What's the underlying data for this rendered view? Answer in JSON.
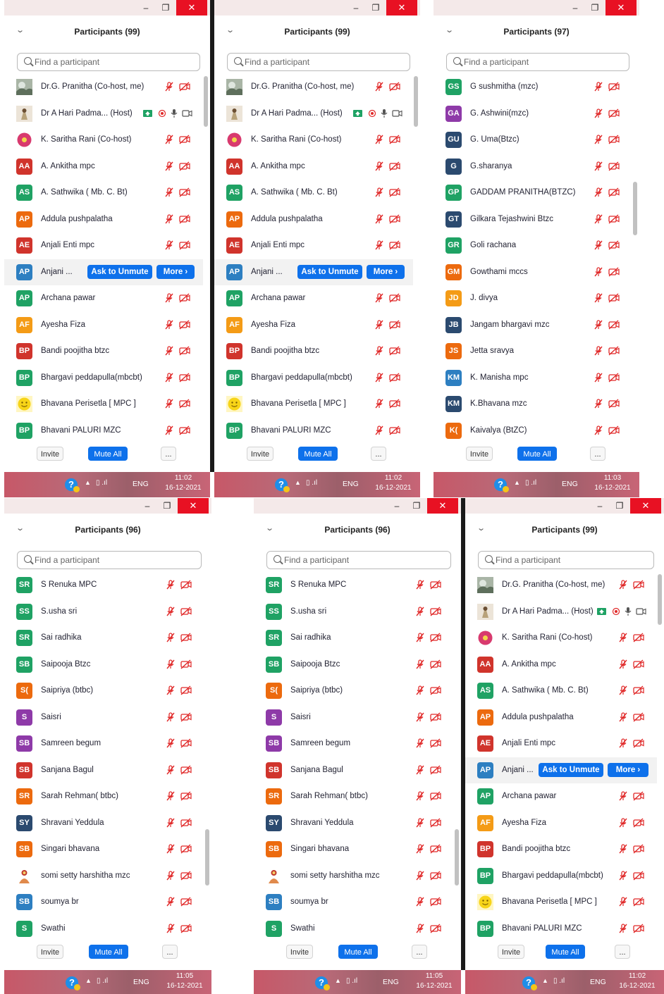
{
  "colors": {
    "accent": "#0e71eb",
    "muted_red": "#e02828",
    "close": "#e81123"
  },
  "common": {
    "search_placeholder": "Find a participant",
    "ask_to_unmute": "Ask to Unmute",
    "more": "More ›",
    "invite": "Invite",
    "mute_all": "Mute All",
    "ellipsis": "...",
    "lang": "ENG",
    "minimize_glyph": "–",
    "restore_glyph": "❐",
    "close_glyph": "✕",
    "chevron_glyph": "⌄",
    "help_glyph": "?",
    "up_glyph": "▲",
    "net_glyph": "▯ .ıl"
  },
  "windows": [
    {
      "title": "Participants (99)",
      "time": "11:02",
      "date": "16-12-2021",
      "participants": [
        {
          "name": "Dr.G. Pranitha (Co-host, me)",
          "initials": "",
          "color": "#8f9a8a",
          "photo": "landscape",
          "status": "muted"
        },
        {
          "name": "Dr A Hari Padma... (Host)",
          "initials": "",
          "color": "#d9cfc0",
          "photo": "doll",
          "status": "host"
        },
        {
          "name": "K. Saritha Rani (Co-host)",
          "initials": "",
          "color": "#d83a6e",
          "photo": "flower",
          "status": "muted"
        },
        {
          "name": "A. Ankitha mpc",
          "initials": "AA",
          "color": "#d0342c",
          "status": "muted"
        },
        {
          "name": "A. Sathwika  ( Mb. C. Bt)",
          "initials": "AS",
          "color": "#1fa264",
          "status": "muted"
        },
        {
          "name": "Addula pushpalatha",
          "initials": "AP",
          "color": "#ec6a0e",
          "status": "muted"
        },
        {
          "name": "Anjali  Enti mpc",
          "initials": "AE",
          "color": "#d0342c",
          "status": "muted"
        },
        {
          "name": "Anjani ...",
          "initials": "AP",
          "color": "#2d7fc1",
          "status": "hover"
        },
        {
          "name": "Archana pawar",
          "initials": "AP",
          "color": "#1fa264",
          "status": "muted"
        },
        {
          "name": "Ayesha Fiza",
          "initials": "AF",
          "color": "#f49b16",
          "status": "muted"
        },
        {
          "name": "Bandi poojitha btzc",
          "initials": "BP",
          "color": "#d0342c",
          "status": "muted"
        },
        {
          "name": "Bhargavi peddapulla(mbcbt)",
          "initials": "BP",
          "color": "#1fa264",
          "status": "muted"
        },
        {
          "name": "Bhavana Perisetla [ MPC ]",
          "initials": "",
          "color": "#f7d418",
          "photo": "smiley",
          "status": "muted"
        },
        {
          "name": "Bhavani PALURI MZC",
          "initials": "BP",
          "color": "#1fa264",
          "status": "muted"
        }
      ]
    },
    {
      "title": "Participants (99)",
      "time": "11:02",
      "date": "16-12-2021",
      "participants": [
        {
          "name": "Dr.G. Pranitha (Co-host, me)",
          "initials": "",
          "color": "#8f9a8a",
          "photo": "landscape",
          "status": "muted"
        },
        {
          "name": "Dr A Hari Padma... (Host)",
          "initials": "",
          "color": "#d9cfc0",
          "photo": "doll",
          "status": "host"
        },
        {
          "name": "K. Saritha Rani (Co-host)",
          "initials": "",
          "color": "#d83a6e",
          "photo": "flower",
          "status": "muted"
        },
        {
          "name": "A. Ankitha mpc",
          "initials": "AA",
          "color": "#d0342c",
          "status": "muted"
        },
        {
          "name": "A. Sathwika  ( Mb. C. Bt)",
          "initials": "AS",
          "color": "#1fa264",
          "status": "muted"
        },
        {
          "name": "Addula pushpalatha",
          "initials": "AP",
          "color": "#ec6a0e",
          "status": "muted"
        },
        {
          "name": "Anjali  Enti mpc",
          "initials": "AE",
          "color": "#d0342c",
          "status": "muted"
        },
        {
          "name": "Anjani ...",
          "initials": "AP",
          "color": "#2d7fc1",
          "status": "hover"
        },
        {
          "name": "Archana pawar",
          "initials": "AP",
          "color": "#1fa264",
          "status": "muted"
        },
        {
          "name": "Ayesha Fiza",
          "initials": "AF",
          "color": "#f49b16",
          "status": "muted"
        },
        {
          "name": "Bandi poojitha btzc",
          "initials": "BP",
          "color": "#d0342c",
          "status": "muted"
        },
        {
          "name": "Bhargavi peddapulla(mbcbt)",
          "initials": "BP",
          "color": "#1fa264",
          "status": "muted"
        },
        {
          "name": "Bhavana Perisetla [ MPC ]",
          "initials": "",
          "color": "#f7d418",
          "photo": "smiley",
          "status": "muted"
        },
        {
          "name": "Bhavani PALURI MZC",
          "initials": "BP",
          "color": "#1fa264",
          "status": "muted"
        }
      ]
    },
    {
      "title": "Participants (97)",
      "time": "11:03",
      "date": "16-12-2021",
      "participants": [
        {
          "name": "G sushmitha (mzc)",
          "initials": "GS",
          "color": "#1fa264",
          "status": "muted"
        },
        {
          "name": "G. Ashwini(mzc)",
          "initials": "GA",
          "color": "#8e3aa8",
          "status": "muted"
        },
        {
          "name": "G. Uma(Btzc)",
          "initials": "GU",
          "color": "#2b4a6f",
          "status": "muted"
        },
        {
          "name": "G.sharanya",
          "initials": "G",
          "color": "#2b4a6f",
          "status": "muted"
        },
        {
          "name": "GADDAM PRANITHA(BTZC)",
          "initials": "GP",
          "color": "#1fa264",
          "status": "muted"
        },
        {
          "name": "Gilkara Tejashwini Btzc",
          "initials": "GT",
          "color": "#2b4a6f",
          "status": "muted"
        },
        {
          "name": "Goli rachana",
          "initials": "GR",
          "color": "#1fa264",
          "status": "muted"
        },
        {
          "name": "Gowthami mccs",
          "initials": "GM",
          "color": "#ec6a0e",
          "status": "muted"
        },
        {
          "name": "J. divya",
          "initials": "JD",
          "color": "#f49b16",
          "status": "muted"
        },
        {
          "name": "Jangam bhargavi mzc",
          "initials": "JB",
          "color": "#2b4a6f",
          "status": "muted"
        },
        {
          "name": "Jetta sravya",
          "initials": "JS",
          "color": "#ec6a0e",
          "status": "muted"
        },
        {
          "name": "K. Manisha mpc",
          "initials": "KM",
          "color": "#2d7fc1",
          "status": "muted"
        },
        {
          "name": "K.Bhavana mzc",
          "initials": "KM",
          "color": "#2b4a6f",
          "status": "muted"
        },
        {
          "name": "Kaivalya (BtZC)",
          "initials": "K(",
          "color": "#ec6a0e",
          "status": "muted"
        }
      ]
    },
    {
      "title": "Participants (96)",
      "time": "11:05",
      "date": "16-12-2021",
      "participants": [
        {
          "name": "S Renuka MPC",
          "initials": "SR",
          "color": "#1fa264",
          "status": "muted"
        },
        {
          "name": "S.usha sri",
          "initials": "SS",
          "color": "#1fa264",
          "status": "muted"
        },
        {
          "name": "Sai radhika",
          "initials": "SR",
          "color": "#1fa264",
          "status": "muted"
        },
        {
          "name": "Saipooja Btzc",
          "initials": "SB",
          "color": "#1fa264",
          "status": "muted"
        },
        {
          "name": "Saipriya (btbc)",
          "initials": "S(",
          "color": "#ec6a0e",
          "status": "muted"
        },
        {
          "name": "Saisri",
          "initials": "S",
          "color": "#8e3aa8",
          "status": "muted"
        },
        {
          "name": "Samreen begum",
          "initials": "SB",
          "color": "#8e3aa8",
          "status": "muted"
        },
        {
          "name": "Sanjana Bagul",
          "initials": "SB",
          "color": "#d0342c",
          "status": "muted"
        },
        {
          "name": "Sarah Rehman( btbc)",
          "initials": "SR",
          "color": "#ec6a0e",
          "status": "muted"
        },
        {
          "name": "Shravani Yeddula",
          "initials": "SY",
          "color": "#2b4a6f",
          "status": "muted"
        },
        {
          "name": "Singari bhavana",
          "initials": "SB",
          "color": "#ec6a0e",
          "status": "muted"
        },
        {
          "name": "somi setty harshitha mzc",
          "initials": "",
          "color": "#e08a4c",
          "photo": "deity",
          "status": "muted"
        },
        {
          "name": "soumya br",
          "initials": "SB",
          "color": "#2d7fc1",
          "status": "muted"
        },
        {
          "name": "Swathi",
          "initials": "S",
          "color": "#1fa264",
          "status": "muted"
        }
      ]
    },
    {
      "title": "Participants (96)",
      "time": "11:05",
      "date": "16-12-2021",
      "participants": [
        {
          "name": "S Renuka MPC",
          "initials": "SR",
          "color": "#1fa264",
          "status": "muted"
        },
        {
          "name": "S.usha sri",
          "initials": "SS",
          "color": "#1fa264",
          "status": "muted"
        },
        {
          "name": "Sai radhika",
          "initials": "SR",
          "color": "#1fa264",
          "status": "muted"
        },
        {
          "name": "Saipooja Btzc",
          "initials": "SB",
          "color": "#1fa264",
          "status": "muted"
        },
        {
          "name": "Saipriya (btbc)",
          "initials": "S(",
          "color": "#ec6a0e",
          "status": "muted"
        },
        {
          "name": "Saisri",
          "initials": "S",
          "color": "#8e3aa8",
          "status": "muted"
        },
        {
          "name": "Samreen begum",
          "initials": "SB",
          "color": "#8e3aa8",
          "status": "muted"
        },
        {
          "name": "Sanjana Bagul",
          "initials": "SB",
          "color": "#d0342c",
          "status": "muted"
        },
        {
          "name": "Sarah Rehman( btbc)",
          "initials": "SR",
          "color": "#ec6a0e",
          "status": "muted"
        },
        {
          "name": "Shravani Yeddula",
          "initials": "SY",
          "color": "#2b4a6f",
          "status": "muted"
        },
        {
          "name": "Singari bhavana",
          "initials": "SB",
          "color": "#ec6a0e",
          "status": "muted"
        },
        {
          "name": "somi setty harshitha mzc",
          "initials": "",
          "color": "#e08a4c",
          "photo": "deity",
          "status": "muted"
        },
        {
          "name": "soumya br",
          "initials": "SB",
          "color": "#2d7fc1",
          "status": "muted"
        },
        {
          "name": "Swathi",
          "initials": "S",
          "color": "#1fa264",
          "status": "muted"
        }
      ]
    },
    {
      "title": "Participants (99)",
      "time": "11:02",
      "date": "16-12-2021",
      "participants": [
        {
          "name": "Dr.G. Pranitha (Co-host, me)",
          "initials": "",
          "color": "#8f9a8a",
          "photo": "landscape",
          "status": "muted"
        },
        {
          "name": "Dr A Hari Padma... (Host)",
          "initials": "",
          "color": "#d9cfc0",
          "photo": "doll",
          "status": "host"
        },
        {
          "name": "K. Saritha Rani (Co-host)",
          "initials": "",
          "color": "#d83a6e",
          "photo": "flower",
          "status": "muted"
        },
        {
          "name": "A. Ankitha mpc",
          "initials": "AA",
          "color": "#d0342c",
          "status": "muted"
        },
        {
          "name": "A. Sathwika  ( Mb. C. Bt)",
          "initials": "AS",
          "color": "#1fa264",
          "status": "muted"
        },
        {
          "name": "Addula pushpalatha",
          "initials": "AP",
          "color": "#ec6a0e",
          "status": "muted"
        },
        {
          "name": "Anjali  Enti mpc",
          "initials": "AE",
          "color": "#d0342c",
          "status": "muted"
        },
        {
          "name": "Anjani ...",
          "initials": "AP",
          "color": "#2d7fc1",
          "status": "hover"
        },
        {
          "name": "Archana pawar",
          "initials": "AP",
          "color": "#1fa264",
          "status": "muted"
        },
        {
          "name": "Ayesha Fiza",
          "initials": "AF",
          "color": "#f49b16",
          "status": "muted"
        },
        {
          "name": "Bandi poojitha btzc",
          "initials": "BP",
          "color": "#d0342c",
          "status": "muted"
        },
        {
          "name": "Bhargavi peddapulla(mbcbt)",
          "initials": "BP",
          "color": "#1fa264",
          "status": "muted"
        },
        {
          "name": "Bhavana Perisetla [ MPC ]",
          "initials": "",
          "color": "#f7d418",
          "photo": "smiley",
          "status": "muted"
        },
        {
          "name": "Bhavani PALURI MZC",
          "initials": "BP",
          "color": "#1fa264",
          "status": "muted"
        }
      ]
    }
  ]
}
